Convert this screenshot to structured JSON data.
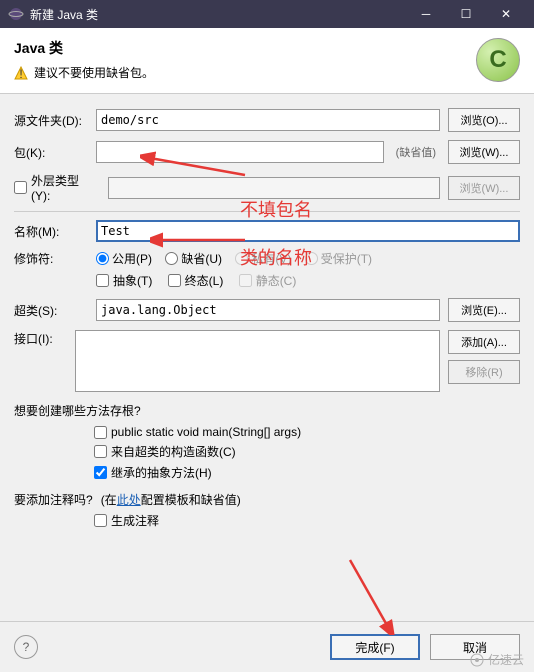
{
  "window": {
    "title": "新建 Java 类"
  },
  "header": {
    "title": "Java 类",
    "warning": "建议不要使用缺省包。"
  },
  "fields": {
    "srcFolder": {
      "label": "源文件夹(D):",
      "value": "demo/src",
      "btn": "浏览(O)..."
    },
    "pkg": {
      "label": "包(K):",
      "value": "",
      "hint": "(缺省值)",
      "btn": "浏览(W)..."
    },
    "enclosing": {
      "label": "外层类型(Y):",
      "value": "",
      "btn": "浏览(W)..."
    },
    "name": {
      "label": "名称(M):",
      "value": "Test"
    },
    "modifiers": {
      "label": "修饰符:",
      "radios": {
        "public": "公用(P)",
        "default": "缺省(U)",
        "private": "私有(V)",
        "protected": "受保护(T)"
      },
      "checks": {
        "abstract": "抽象(T)",
        "final": "终态(L)",
        "static": "静态(C)"
      }
    },
    "superclass": {
      "label": "超类(S):",
      "value": "java.lang.Object",
      "btn": "浏览(E)..."
    },
    "interfaces": {
      "label": "接口(I):",
      "addBtn": "添加(A)...",
      "removeBtn": "移除(R)"
    }
  },
  "stubs": {
    "question": "想要创建哪些方法存根?",
    "main": "public static void main(String[] args)",
    "super": "来自超类的构造函数(C)",
    "inherit": "继承的抽象方法(H)"
  },
  "comments": {
    "question": "要添加注释吗?",
    "configPrefix": "(在",
    "configLink": "此处",
    "configSuffix": "配置模板和缺省值)",
    "gen": "生成注释"
  },
  "footer": {
    "finish": "完成(F)",
    "cancel": "取消"
  },
  "annotations": {
    "noPkg": "不填包名",
    "className": "类的名称"
  },
  "watermark": "亿速云"
}
